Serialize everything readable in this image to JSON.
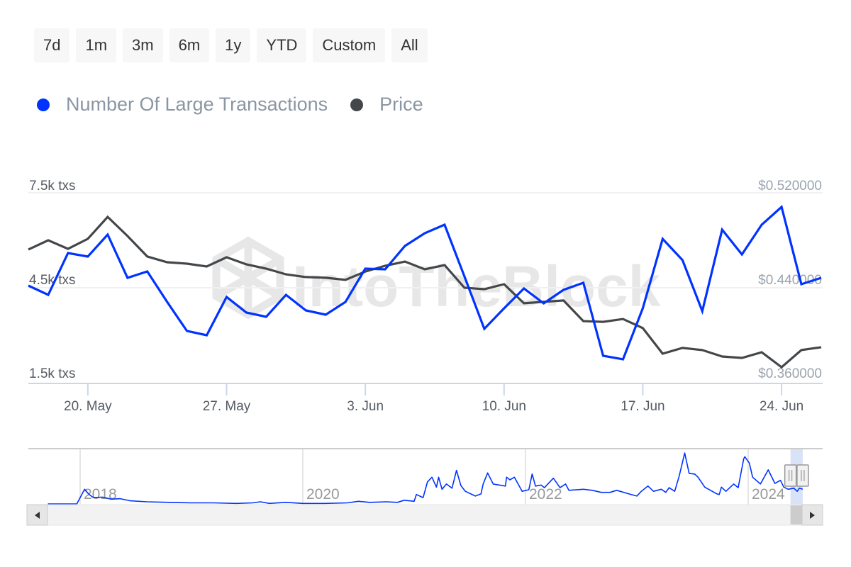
{
  "range_selector": {
    "buttons": [
      {
        "label": "7d"
      },
      {
        "label": "1m"
      },
      {
        "label": "3m"
      },
      {
        "label": "6m"
      },
      {
        "label": "1y"
      },
      {
        "label": "YTD"
      },
      {
        "label": "Custom"
      },
      {
        "label": "All"
      }
    ]
  },
  "legend": {
    "items": [
      {
        "label": "Number Of Large Transactions",
        "color": "#0033ff"
      },
      {
        "label": "Price",
        "color": "#44474a"
      }
    ]
  },
  "watermark": "IntoTheBlock",
  "navigator": {
    "year_labels": [
      "2018",
      "2020",
      "2022",
      "2024"
    ],
    "scroll_left_icon": "◀",
    "scroll_right_icon": "▶"
  },
  "chart_data": {
    "type": "line",
    "title": "",
    "xlabel": "",
    "x_start": "17 May",
    "x_end": "26 Jun",
    "x_tick_labels": [
      "20. May",
      "27. May",
      "3. Jun",
      "10. Jun",
      "17. Jun",
      "24. Jun"
    ],
    "x_tick_day_index": [
      3,
      10,
      17,
      24,
      31,
      38
    ],
    "y_left": {
      "label": "",
      "tick_labels": [
        "7.5k txs",
        "4.5k txs",
        "1.5k txs"
      ],
      "ticks": [
        7500,
        4500,
        1500
      ],
      "range": [
        1500,
        7500
      ]
    },
    "y_right": {
      "label": "",
      "tick_labels": [
        "$0.520000",
        "$0.440000",
        "$0.360000"
      ],
      "ticks": [
        0.52,
        0.44,
        0.36
      ],
      "range": [
        0.36,
        0.52
      ]
    },
    "grid": true,
    "legend_position": "top-left",
    "series": [
      {
        "name": "Number Of Large Transactions",
        "axis": "left",
        "color": "#0033ff",
        "values": [
          4567,
          4276,
          5597,
          5485,
          6179,
          4813,
          5015,
          4052,
          3134,
          2999,
          4209,
          3716,
          3582,
          4276,
          3783,
          3649,
          4052,
          5104,
          5082,
          5821,
          6224,
          6493,
          4858,
          3201,
          3850,
          4478,
          4007,
          4433,
          4657,
          2351,
          2239,
          3850,
          6045,
          5373,
          3761,
          6336,
          5552,
          6493,
          7052,
          4612,
          4813
        ]
      },
      {
        "name": "Price",
        "axis": "right",
        "color": "#44474a",
        "values": [
          0.4722,
          0.48,
          0.4728,
          0.4812,
          0.4997,
          0.4836,
          0.4663,
          0.4615,
          0.4603,
          0.4579,
          0.4657,
          0.4597,
          0.4561,
          0.4513,
          0.449,
          0.4484,
          0.4466,
          0.4537,
          0.4585,
          0.4621,
          0.4555,
          0.4591,
          0.44,
          0.4388,
          0.443,
          0.4269,
          0.4281,
          0.4293,
          0.4119,
          0.4113,
          0.4137,
          0.406,
          0.3845,
          0.3893,
          0.3875,
          0.3821,
          0.3809,
          0.3857,
          0.3731,
          0.3875,
          0.3899
        ]
      }
    ],
    "navigator_series": {
      "name": "Number Of Large Transactions (full history, relative level)",
      "x_range_years": [
        2017.71,
        2024.49
      ],
      "selected_range_years": [
        2024.38,
        2024.49
      ],
      "points": [
        [
          2017.71,
          0.0
        ],
        [
          2017.97,
          0.0
        ],
        [
          2018.04,
          0.28
        ],
        [
          2018.08,
          0.18
        ],
        [
          2018.12,
          0.12
        ],
        [
          2018.2,
          0.13
        ],
        [
          2018.28,
          0.09
        ],
        [
          2018.36,
          0.1
        ],
        [
          2018.45,
          0.06
        ],
        [
          2018.6,
          0.04
        ],
        [
          2018.8,
          0.03
        ],
        [
          2019.0,
          0.02
        ],
        [
          2019.2,
          0.02
        ],
        [
          2019.4,
          0.01
        ],
        [
          2019.55,
          0.02
        ],
        [
          2019.62,
          0.04
        ],
        [
          2019.7,
          0.01
        ],
        [
          2019.85,
          0.03
        ],
        [
          2020.0,
          0.01
        ],
        [
          2020.2,
          0.01
        ],
        [
          2020.4,
          0.02
        ],
        [
          2020.5,
          0.05
        ],
        [
          2020.6,
          0.03
        ],
        [
          2020.75,
          0.04
        ],
        [
          2020.85,
          0.03
        ],
        [
          2020.91,
          0.07
        ],
        [
          2021.0,
          0.05
        ],
        [
          2021.02,
          0.18
        ],
        [
          2021.08,
          0.12
        ],
        [
          2021.12,
          0.42
        ],
        [
          2021.16,
          0.51
        ],
        [
          2021.2,
          0.32
        ],
        [
          2021.22,
          0.51
        ],
        [
          2021.25,
          0.28
        ],
        [
          2021.29,
          0.38
        ],
        [
          2021.34,
          0.3
        ],
        [
          2021.38,
          0.64
        ],
        [
          2021.42,
          0.35
        ],
        [
          2021.46,
          0.24
        ],
        [
          2021.55,
          0.15
        ],
        [
          2021.6,
          0.19
        ],
        [
          2021.62,
          0.38
        ],
        [
          2021.66,
          0.59
        ],
        [
          2021.71,
          0.38
        ],
        [
          2021.82,
          0.34
        ],
        [
          2021.83,
          0.51
        ],
        [
          2021.86,
          0.46
        ],
        [
          2021.9,
          0.51
        ],
        [
          2021.97,
          0.24
        ],
        [
          2022.03,
          0.27
        ],
        [
          2022.06,
          0.57
        ],
        [
          2022.09,
          0.34
        ],
        [
          2022.14,
          0.36
        ],
        [
          2022.17,
          0.31
        ],
        [
          2022.25,
          0.49
        ],
        [
          2022.31,
          0.31
        ],
        [
          2022.36,
          0.38
        ],
        [
          2022.39,
          0.26
        ],
        [
          2022.52,
          0.28
        ],
        [
          2022.6,
          0.26
        ],
        [
          2022.68,
          0.22
        ],
        [
          2022.76,
          0.22
        ],
        [
          2022.82,
          0.26
        ],
        [
          2022.93,
          0.19
        ],
        [
          2023.0,
          0.15
        ],
        [
          2023.04,
          0.24
        ],
        [
          2023.1,
          0.34
        ],
        [
          2023.15,
          0.24
        ],
        [
          2023.22,
          0.28
        ],
        [
          2023.26,
          0.22
        ],
        [
          2023.29,
          0.31
        ],
        [
          2023.34,
          0.24
        ],
        [
          2023.38,
          0.53
        ],
        [
          2023.43,
          0.97
        ],
        [
          2023.47,
          0.58
        ],
        [
          2023.52,
          0.57
        ],
        [
          2023.55,
          0.51
        ],
        [
          2023.61,
          0.32
        ],
        [
          2023.72,
          0.19
        ],
        [
          2023.74,
          0.18
        ],
        [
          2023.76,
          0.32
        ],
        [
          2023.8,
          0.24
        ],
        [
          2023.87,
          0.38
        ],
        [
          2023.91,
          0.31
        ],
        [
          2023.96,
          0.86
        ],
        [
          2023.97,
          0.9
        ],
        [
          2024.01,
          0.78
        ],
        [
          2024.04,
          0.51
        ],
        [
          2024.11,
          0.38
        ],
        [
          2024.18,
          0.65
        ],
        [
          2024.24,
          0.39
        ],
        [
          2024.29,
          0.45
        ],
        [
          2024.32,
          0.32
        ],
        [
          2024.36,
          0.28
        ],
        [
          2024.41,
          0.3
        ],
        [
          2024.44,
          0.24
        ],
        [
          2024.46,
          0.3
        ],
        [
          2024.49,
          0.28
        ]
      ]
    }
  }
}
